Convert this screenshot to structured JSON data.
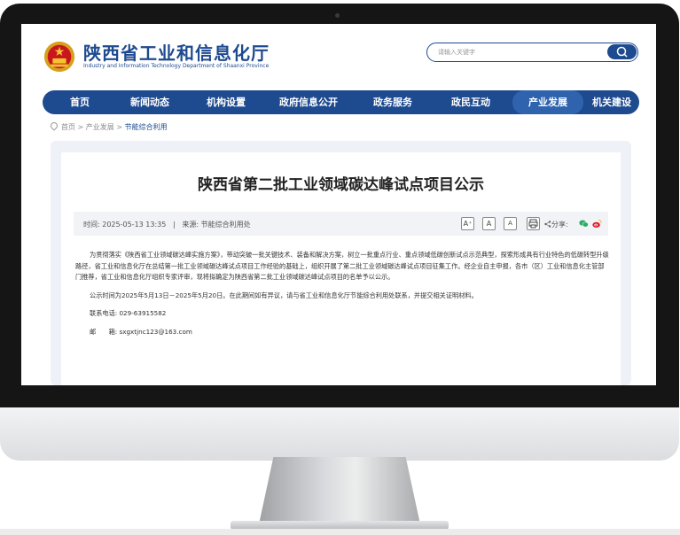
{
  "site": {
    "name_cn": "陕西省工业和信息化厅",
    "name_en": "Industry and Information Technology Department of Shaanxi Province"
  },
  "search": {
    "placeholder": "请输入关键字"
  },
  "nav": {
    "items": [
      "首页",
      "新闻动态",
      "机构设置",
      "政府信息公开",
      "政务服务",
      "政民互动",
      "产业发展",
      "机关建设"
    ],
    "active": "产业发展"
  },
  "breadcrumb": {
    "home": "首页",
    "sep1": ">",
    "level1": "产业发展",
    "sep2": ">",
    "current": "节能综合利用"
  },
  "article": {
    "title": "陕西省第二批工业领域碳达峰试点项目公示",
    "meta": {
      "time_label": "时间:",
      "time": "2025-05-13 13:35",
      "sep": "|",
      "source_label": "来源:",
      "source": "节能综合利用处"
    },
    "font_buttons": [
      "A⁺",
      "A",
      "A"
    ],
    "share_label": "分享:",
    "paragraphs": [
      "为贯彻落实《陕西省工业领域碳达峰实施方案》，带动突破一批关键技术、装备和解决方案，树立一批重点行业、重点领域低碳创新试点示范典型，探索形成具有行业特色的低碳转型升级路径，省工业和信息化厅在总结第一批工业领域碳达峰试点项目工作经验的基础上，组织开展了第二批工业领域碳达峰试点项目征集工作。经企业自主申报，各市（区）工业和信息化主管部门推荐，省工业和信息化厅组织专家评审，现将拟确定为陕西省第二批工业领域碳达峰试点项目的名单予以公示。",
      "公示时间为2025年5月13日－2025年5月20日。在此期间如有异议，请与省工业和信息化厅节能综合利用处联系，并提交相关证明材料。"
    ],
    "contact": {
      "phone_label": "联系电话:",
      "phone": "029-63915582",
      "email_label": "邮　　箱:",
      "email": "sxgxtjnc123@163.com"
    }
  },
  "colors": {
    "brand": "#1e4a8f",
    "nav_active": "#2f63ad",
    "meta_bg": "#f2f3f7",
    "frame_bg": "#eef1f7"
  }
}
